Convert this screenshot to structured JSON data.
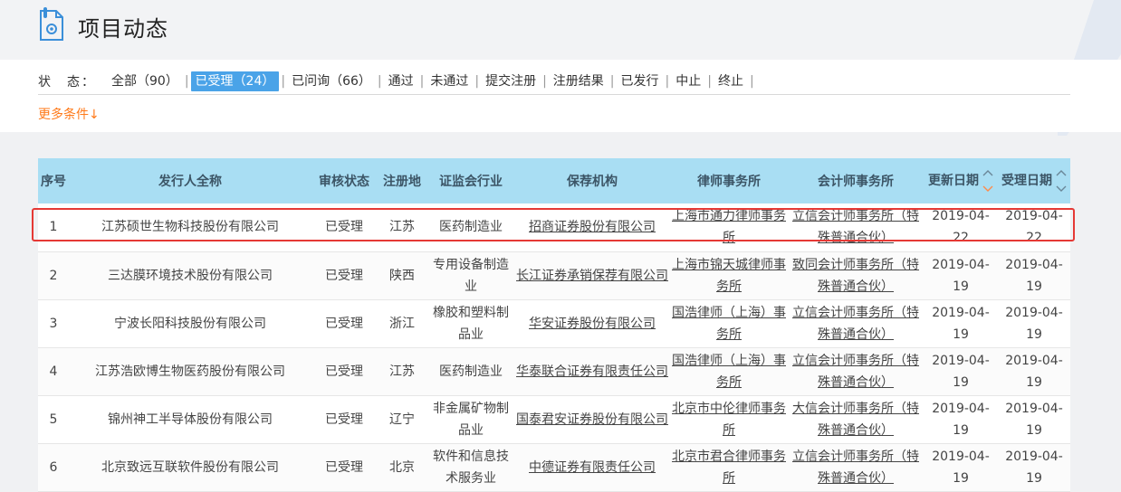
{
  "header": {
    "title": "项目动态"
  },
  "filter": {
    "status_label": "状　态：",
    "statuses": [
      {
        "label": "全部（90）"
      },
      {
        "label": "已受理（24）"
      },
      {
        "label": "已问询（66）"
      },
      {
        "label": "通过"
      },
      {
        "label": "未通过"
      },
      {
        "label": "提交注册"
      },
      {
        "label": "注册结果"
      },
      {
        "label": "已发行"
      },
      {
        "label": "中止"
      },
      {
        "label": "终止"
      }
    ],
    "active_index": 1,
    "more_label": "更多条件↓"
  },
  "table": {
    "columns": [
      "序号",
      "发行人全称",
      "审核状态",
      "注册地",
      "证监会行业",
      "保荐机构",
      "律师事务所",
      "会计师事务所",
      "更新日期",
      "受理日期"
    ],
    "rows": [
      {
        "no": "1",
        "name": "江苏硕世生物科技股份有限公司",
        "status": "已受理",
        "region": "江苏",
        "industry": "医药制造业",
        "sponsor": "招商证券股份有限公司",
        "law": "上海市通力律师事务所",
        "accounting": "立信会计师事务所（特殊普通合伙）",
        "updated": "2019-04-22",
        "accepted": "2019-04-22"
      },
      {
        "no": "2",
        "name": "三达膜环境技术股份有限公司",
        "status": "已受理",
        "region": "陕西",
        "industry": "专用设备制造业",
        "sponsor": "长江证券承销保荐有限公司",
        "law": "上海市锦天城律师事务所",
        "accounting": "致同会计师事务所（特殊普通合伙）",
        "updated": "2019-04-19",
        "accepted": "2019-04-19"
      },
      {
        "no": "3",
        "name": "宁波长阳科技股份有限公司",
        "status": "已受理",
        "region": "浙江",
        "industry": "橡胶和塑料制品业",
        "sponsor": "华安证券股份有限公司",
        "law": "国浩律师（上海）事务所",
        "accounting": "立信会计师事务所（特殊普通合伙）",
        "updated": "2019-04-19",
        "accepted": "2019-04-19"
      },
      {
        "no": "4",
        "name": "江苏浩欧博生物医药股份有限公司",
        "status": "已受理",
        "region": "江苏",
        "industry": "医药制造业",
        "sponsor": "华泰联合证券有限责任公司",
        "law": "国浩律师（上海）事务所",
        "accounting": "立信会计师事务所（特殊普通合伙）",
        "updated": "2019-04-19",
        "accepted": "2019-04-19"
      },
      {
        "no": "5",
        "name": "锦州神工半导体股份有限公司",
        "status": "已受理",
        "region": "辽宁",
        "industry": "非金属矿物制品业",
        "sponsor": "国泰君安证券股份有限公司",
        "law": "北京市中伦律师事务所",
        "accounting": "大信会计师事务所（特殊普通合伙）",
        "updated": "2019-04-19",
        "accepted": "2019-04-19"
      },
      {
        "no": "6",
        "name": "北京致远互联软件股份有限公司",
        "status": "已受理",
        "region": "北京",
        "industry": "软件和信息技术服务业",
        "sponsor": "中德证券有限责任公司",
        "law": "北京市君合律师事务所",
        "accounting": "立信会计师事务所（特殊普通合伙）",
        "updated": "2019-04-19",
        "accepted": "2019-04-19"
      }
    ]
  },
  "colors": {
    "accent": "#4aa3e8",
    "header_bg": "#a9def3",
    "more": "#ff7a1a",
    "highlight": "#e53935"
  }
}
